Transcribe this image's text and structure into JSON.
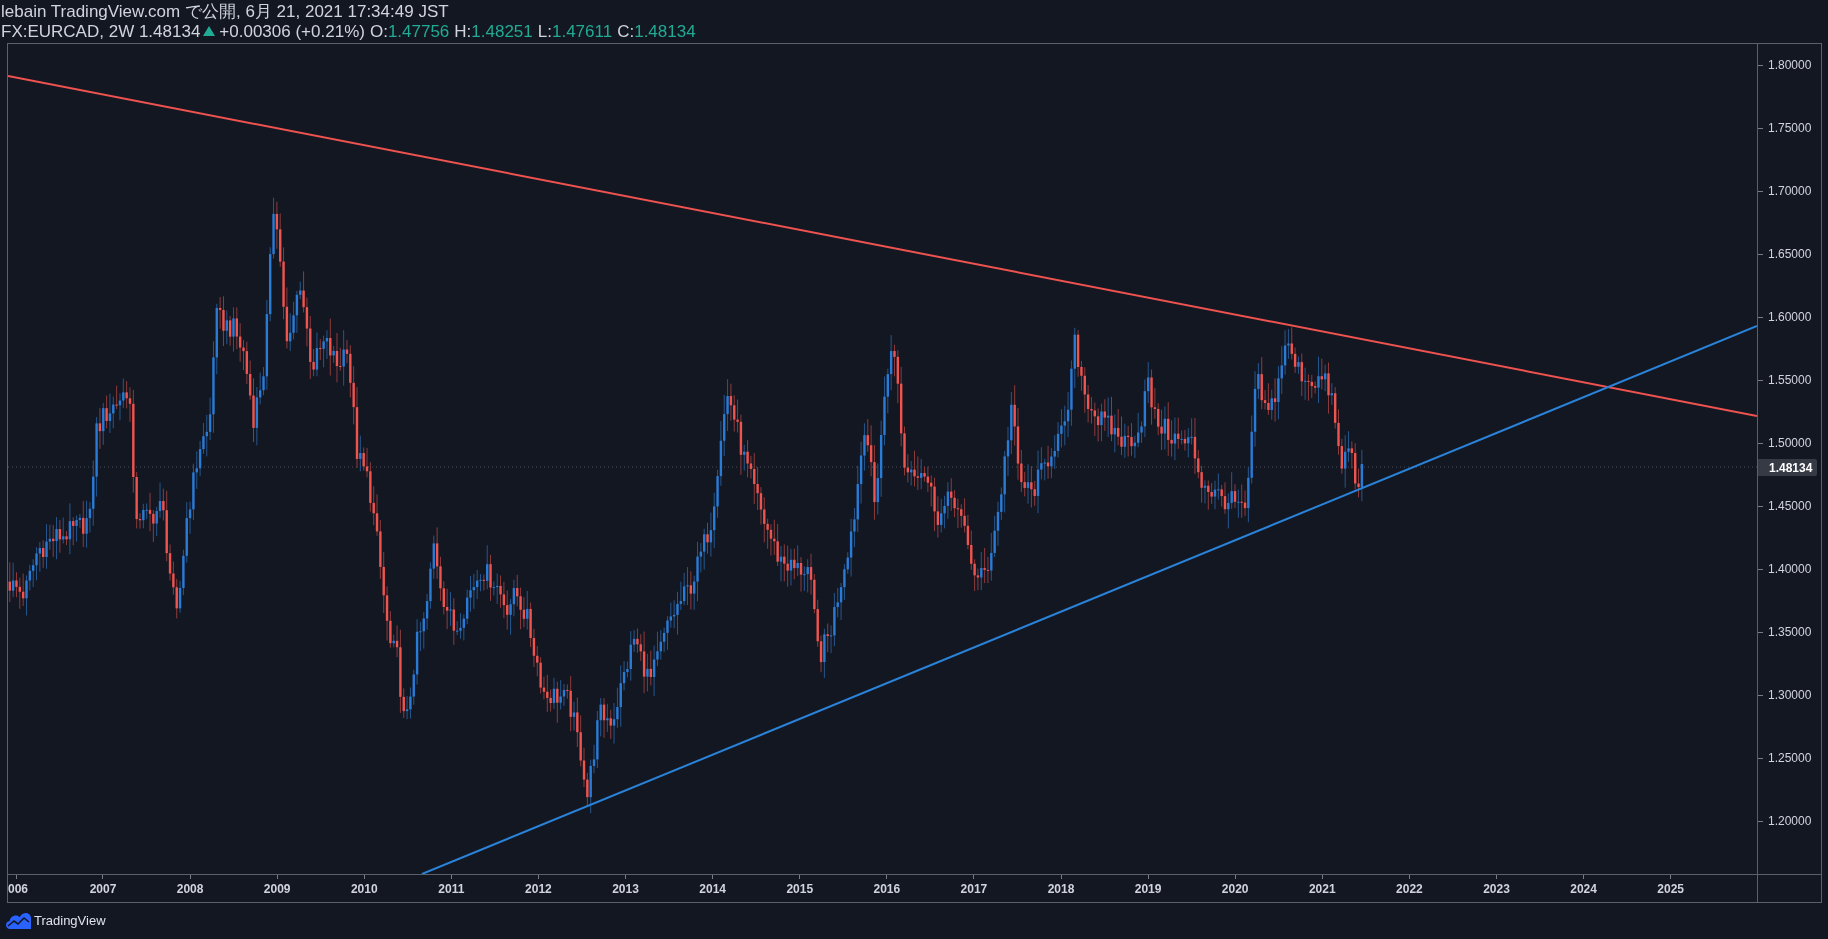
{
  "header": {
    "publication": "lebain TradingView.com で公開, 6月 21, 2021 17:34:49 JST",
    "quote": {
      "symbol": "FX:EURCAD, 2W 1.48134",
      "rising": true,
      "change": "+0.00306 (+0.21%)",
      "ohlc": [
        {
          "label": "O:",
          "value": "1.47756"
        },
        {
          "label": "H:",
          "value": "1.48251"
        },
        {
          "label": "L:",
          "value": "1.47611"
        },
        {
          "label": "C:",
          "value": "1.48134"
        }
      ]
    }
  },
  "chart": {
    "price_axis": {
      "labels": [
        "1.80000",
        "1.75000",
        "1.70000",
        "1.65000",
        "1.60000",
        "1.55000",
        "1.50000",
        "1.45000",
        "1.40000",
        "1.35000",
        "1.30000",
        "1.25000",
        "1.20000"
      ],
      "current_price": "1.48134"
    },
    "time_axis": {
      "labels": [
        "006",
        "2007",
        "2008",
        "2009",
        "2010",
        "2011",
        "2012",
        "2013",
        "2014",
        "2015",
        "2016",
        "2017",
        "2018",
        "2019",
        "2020",
        "2021",
        "2022",
        "2023",
        "2024",
        "2025"
      ]
    }
  },
  "footer": {
    "brand": "TradingView"
  }
}
